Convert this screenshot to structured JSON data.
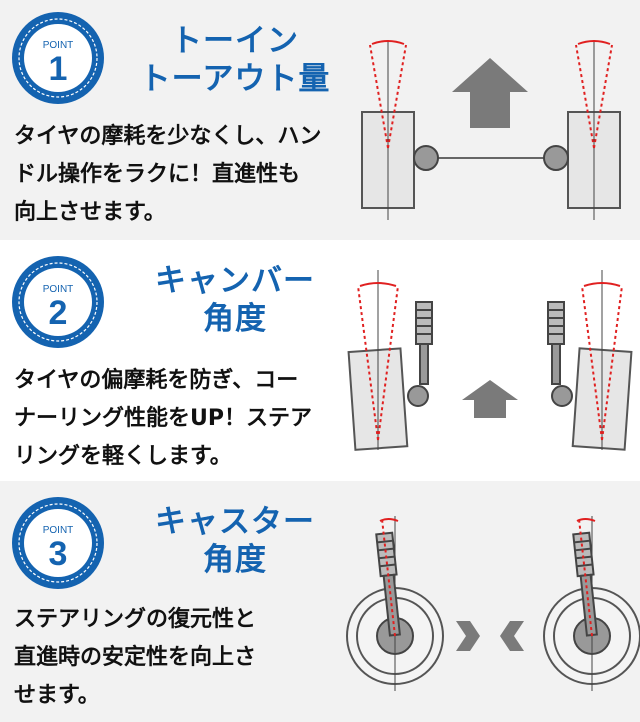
{
  "points": [
    {
      "badge_label": "POINT",
      "number": "1",
      "title_lines": [
        "トーイン",
        "トーアウト量"
      ],
      "desc_lines": [
        "タイヤの摩耗を少なくし、ハン",
        "ドル操作をラクに！直進性も",
        "向上させます。"
      ]
    },
    {
      "badge_label": "POINT",
      "number": "2",
      "title_lines": [
        "キャンバー",
        "角度"
      ],
      "desc_lines": [
        "タイヤの偏摩耗を防ぎ、コー",
        "ナーリング性能をUP！ステア",
        "リングを軽くします。"
      ]
    },
    {
      "badge_label": "POINT",
      "number": "3",
      "title_lines": [
        "キャスター",
        "角度"
      ],
      "desc_lines": [
        "ステアリングの復元性と",
        "直進時の安定性を向上さ",
        "せます。"
      ]
    }
  ],
  "colors": {
    "brand_blue": "#1463b0",
    "badge_dark": "#0d3f86",
    "angle_red": "#e02020",
    "tire_fill": "#e6e6e6",
    "arrow_gray": "#7a7a7a"
  }
}
